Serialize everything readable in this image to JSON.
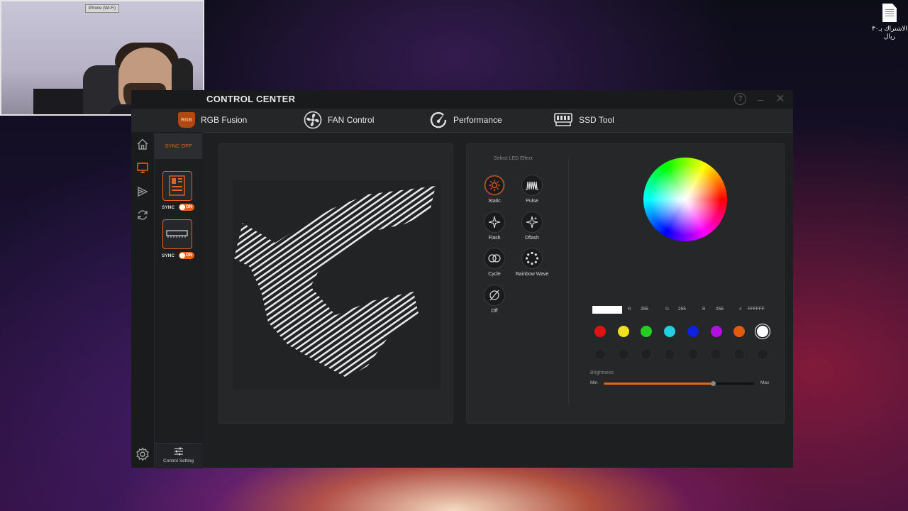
{
  "webcam": {
    "label": "iPhone (Wi-Fi)"
  },
  "desktop_file": {
    "name": "الاشتراك بـ٣٠ ريال"
  },
  "window": {
    "title": "CONTROL CENTER",
    "help": "?",
    "minimize": "–",
    "close": "✕"
  },
  "nav": {
    "tabs": [
      {
        "label": "RGB Fusion",
        "icon": "rgb-fusion-icon",
        "badge": "RGB"
      },
      {
        "label": "FAN Control",
        "icon": "fan-icon"
      },
      {
        "label": "Performance",
        "icon": "performance-gauge-icon"
      },
      {
        "label": "SSD Tool",
        "icon": "ssd-icon"
      }
    ]
  },
  "rail": {
    "items": [
      "home-icon",
      "monitor-icon",
      "play-icon",
      "sync-icon"
    ],
    "settings_icon": "gear-icon"
  },
  "devices": {
    "sync_off_label": "SYNC OFF",
    "items": [
      {
        "type": "motherboard",
        "sync_label": "SYNC",
        "toggle": "ON"
      },
      {
        "type": "memory",
        "sync_label": "SYNC",
        "toggle": "ON"
      }
    ],
    "control_setting_label": "Control Setting"
  },
  "effects": {
    "heading": "Select LED Effect",
    "items": [
      {
        "label": "Static",
        "icon": "sun-icon",
        "selected": true
      },
      {
        "label": "Pulse",
        "icon": "wave-icon"
      },
      {
        "label": "Flash",
        "icon": "sparkle-icon"
      },
      {
        "label": "Dflash",
        "icon": "sparkle-double-icon"
      },
      {
        "label": "Cycle",
        "icon": "cycle-icon"
      },
      {
        "label": "Rainbow Wave",
        "icon": "dots-ring-icon"
      },
      {
        "label": "Off",
        "icon": "off-icon"
      }
    ]
  },
  "color": {
    "r_label": "R",
    "r_value": "255",
    "g_label": "G",
    "g_value": "255",
    "b_label": "B",
    "b_value": "255",
    "hex_label": "#",
    "hex_value": "FFFFFF",
    "preset_colors": [
      "#e01212",
      "#f0e020",
      "#22d020",
      "#20d0e0",
      "#1020e0",
      "#b010e0",
      "#e05a10",
      "#ffffff"
    ],
    "selected_color": "#ffffff",
    "brightness_label": "Brightness",
    "brightness_min": "Min",
    "brightness_max": "Max",
    "brightness_value": 0.73
  },
  "accent": "#e8621c"
}
